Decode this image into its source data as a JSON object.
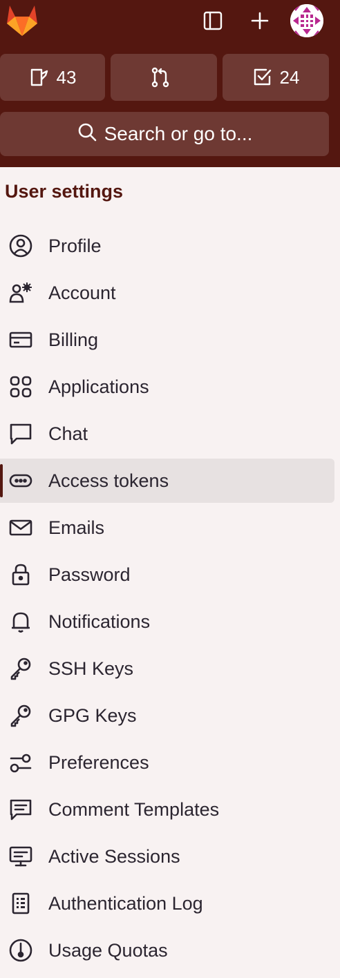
{
  "colors": {
    "topbar_bg": "#541710",
    "button_bg": "#6e3933",
    "accent": "#541710",
    "active_item_bg": "#e7e1e1",
    "page_bg": "#f8f2f2"
  },
  "header": {
    "logo": "tanuki-logo",
    "sidebar_toggle_icon": "sidebar-toggle-icon",
    "new_icon": "plus-icon",
    "avatar": "user-avatar",
    "counters": {
      "issues": "43",
      "merge_requests": "",
      "todos": "24"
    },
    "search_label": "Search or go to..."
  },
  "sidebar": {
    "title": "User settings",
    "items": [
      {
        "label": "Profile",
        "icon": "profile-icon"
      },
      {
        "label": "Account",
        "icon": "account-icon"
      },
      {
        "label": "Billing",
        "icon": "credit-card-icon"
      },
      {
        "label": "Applications",
        "icon": "applications-icon"
      },
      {
        "label": "Chat",
        "icon": "comment-icon"
      },
      {
        "label": "Access tokens",
        "icon": "token-icon",
        "active": true
      },
      {
        "label": "Emails",
        "icon": "mail-icon"
      },
      {
        "label": "Password",
        "icon": "lock-icon"
      },
      {
        "label": "Notifications",
        "icon": "bell-icon"
      },
      {
        "label": "SSH Keys",
        "icon": "key-icon"
      },
      {
        "label": "GPG Keys",
        "icon": "key-icon"
      },
      {
        "label": "Preferences",
        "icon": "preferences-icon"
      },
      {
        "label": "Comment Templates",
        "icon": "comment-lines-icon"
      },
      {
        "label": "Active Sessions",
        "icon": "monitor-icon"
      },
      {
        "label": "Authentication Log",
        "icon": "log-icon"
      },
      {
        "label": "Usage Quotas",
        "icon": "quota-icon"
      }
    ]
  }
}
